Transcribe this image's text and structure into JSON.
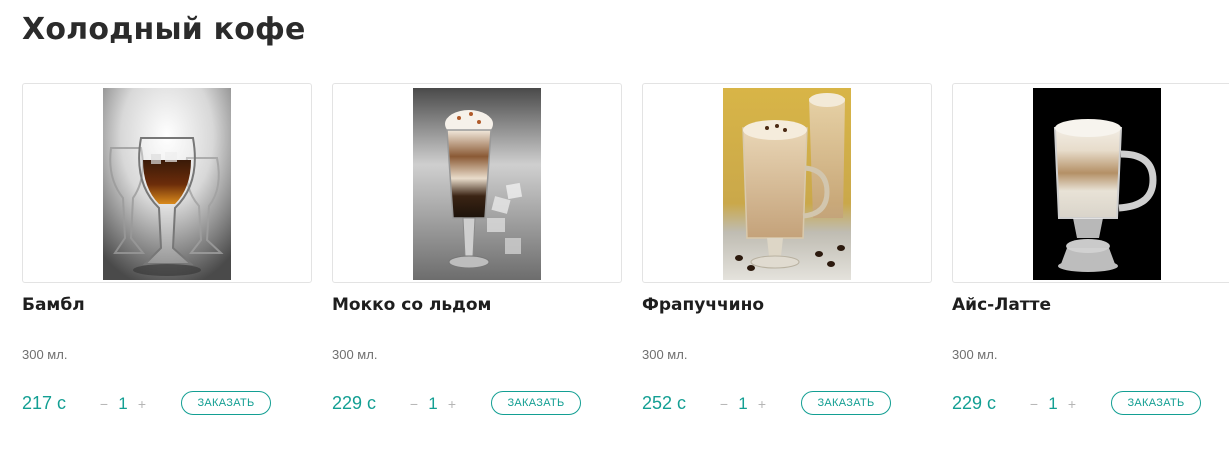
{
  "section": {
    "title": "Холодный кофе"
  },
  "products": [
    {
      "name": "Бамбл",
      "image_alt": "Бамбл",
      "volume": "300 мл.",
      "price": "217 с",
      "qty": "1",
      "minus": "−",
      "plus": "+",
      "order_label": "Заказать"
    },
    {
      "name": "Мокко со льдом",
      "image_alt": "Мокко со льдом",
      "volume": "300 мл.",
      "price": "229 с",
      "qty": "1",
      "minus": "−",
      "plus": "+",
      "order_label": "Заказать"
    },
    {
      "name": "Фрапуччино",
      "image_alt": "Фрапуччино",
      "volume": "300 мл.",
      "price": "252 с",
      "qty": "1",
      "minus": "−",
      "plus": "+",
      "order_label": "Заказать"
    },
    {
      "name": "Айс-Латте",
      "image_alt": "Айс-Латте",
      "volume": "300 мл.",
      "price": "229 с",
      "qty": "1",
      "minus": "−",
      "plus": "+",
      "order_label": "Заказать"
    }
  ],
  "colors": {
    "accent": "#139f93",
    "card_border": "#e3e3e3",
    "title": "#2b2b2b"
  }
}
